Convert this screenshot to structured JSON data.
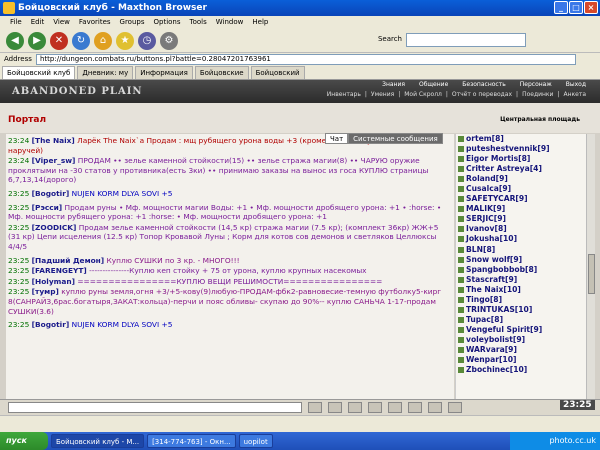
{
  "window": {
    "title": "Бойцовский клуб - Maxthon Browser"
  },
  "menu": [
    "File",
    "Edit",
    "View",
    "Favorites",
    "Groups",
    "Options",
    "Tools",
    "Window",
    "Help"
  ],
  "toolbar": {
    "search_label": "Search"
  },
  "address": {
    "label": "Address",
    "url": "http://dungeon.combats.ru/buttons.pl?battle=0.28047201763961"
  },
  "tabs": [
    "Бойцовский клуб",
    "Дневник: му",
    "Информация",
    "Бойцовские",
    "Бойцовский"
  ],
  "site": {
    "logo": "ABANDONED PLAIN",
    "nav": [
      "Знания",
      "Общение",
      "Безопасность",
      "Персонаж",
      "Выход"
    ],
    "nav2": [
      "Инвентарь",
      "Умения",
      "Мой Скролл",
      "Отчёт о переводах",
      "Поединки",
      "Анкета"
    ]
  },
  "portal": {
    "title": "Портал",
    "location": "Центральная площадь"
  },
  "chat_tabs": [
    "Чат",
    "Системные сообщения"
  ],
  "messages": [
    {
      "time": "23:24",
      "nick": "[The Naix]",
      "text": "Ларёк The Naix`а   Продам : мщ рубящего урона воды +3 (кроме шлема амулета сапог и наручей)",
      "color": "red"
    },
    {
      "time": "23:24",
      "nick": "[Viper_sw]",
      "text": "ПРОДАМ •• зелье каменной стойкости(15) •• зелье стража магии(8) •• ЧАРУЮ оружие проклятыми на -30 статов у противника(есть 3ки) •• принимаю заказы на вынос из госа КУПЛЮ страницы 6,7,13,14(дорого)",
      "color": "purple"
    },
    {
      "time": "23:25",
      "nick": "[Bogotir]",
      "text": "NUJEN KORM DLYA SOVI +5",
      "color": "blue"
    },
    {
      "time": "23:25",
      "nick": "[Рэсси]",
      "text": "Продам руны • Мф. мощности магии Воды: +1 • Мф. мощности дробящего урона: +1 • :horse: • Мф. мощности рубящего урона: +1 :horse: • Мф. мощности дробящего урона: +1",
      "color": "purple"
    },
    {
      "time": "23:25",
      "nick": "[ZOODICK]",
      "text": "Продам зелье каменной стойкости (14,5 кр) стража магии (7.5 кр); (комплект 36кр) ЖЖ+5 (31 кр) Цепи исцеления (12.5 кр) Топор Кровавой Луны ; Корм для котов сов демонов и светляков Целлюксы 4/4/5",
      "color": "purple"
    },
    {
      "time": "23:25",
      "nick": "[Падший Демон]",
      "text": "Куплю СУШКИ по 3 кр. - МНОГО!!!",
      "color": "mag"
    },
    {
      "time": "23:25",
      "nick": "[FARENGEYT]",
      "text": "---------------Куплю кеп стойку + 75 от урона, куплю крупных насекомых",
      "color": "purple"
    },
    {
      "time": "23:25",
      "nick": "[Holyman]",
      "text": "================КУПЛЮ ВЕЩИ РЕШИМОСТИ================",
      "color": "purple"
    },
    {
      "time": "23:25",
      "nick": "[тумр]",
      "text": "куплю руны земля,огня +3/+5-кову(9)любую-ПРОДАМ-фбк2-равновесие-темную футболку5-кирг 8(САНРАЙЗ,6рас.богатыря,ЗАКАТ:кольца)-перчи и пояс обливы- скупаю до 90%-- куплю САНЬЧА 1-17-продам СУШКИ(3.6)",
      "color": "mag"
    },
    {
      "time": "23:25",
      "nick": "[Bogotir]",
      "text": "NUJEN KORM DLYA SOVI +5",
      "color": "blue"
    }
  ],
  "players": [
    "ortem[8]",
    "puteshestvennik[9]",
    "Eigor Mortis[8]",
    "Critter Astreya[4]",
    "Roland[9]",
    "Cusalca[9]",
    "SAFETYCAR[9]",
    "MALIK[9]",
    "SERJIC[9]",
    "Ivanov[8]",
    "Jokusha[10]",
    "BLN[8]",
    "Snow wolf[9]",
    "Spangbobbob[8]",
    "Stascraft[9]",
    "The Naix[10]",
    "Tingo[8]",
    "TRINTUKAS[10]",
    "Tupac[8]",
    "Vengeful Spirit[9]",
    "voleybolist[9]",
    "WARvara[9]",
    "Wenpar[10]",
    "Zbochinec[10]"
  ],
  "clock": "23:25",
  "taskbar": {
    "start": "пуск",
    "items": [
      "Бойцовский клуб - M...",
      "[314-774-763] - Окн...",
      "uopilot"
    ],
    "tray": "photo.cc.uk"
  }
}
